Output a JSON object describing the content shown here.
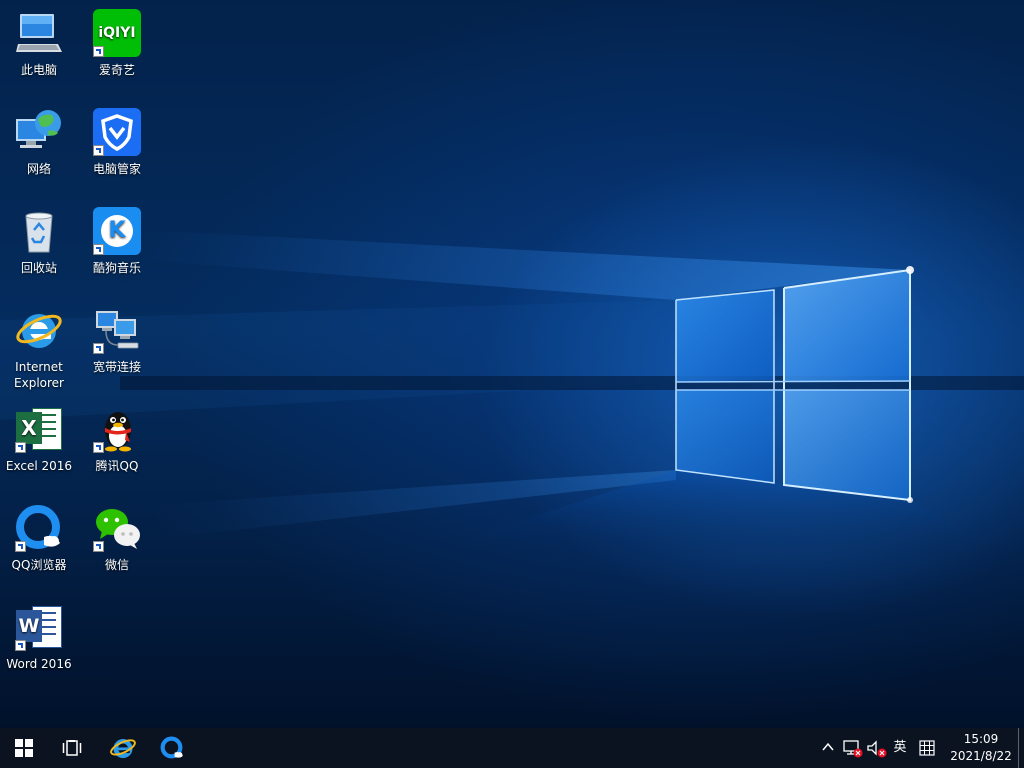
{
  "desktop": {
    "icons": [
      {
        "id": "this-pc",
        "label": "此电脑"
      },
      {
        "id": "iqiyi",
        "label": "爱奇艺",
        "tile_text": "iQIYI"
      },
      {
        "id": "network",
        "label": "网络"
      },
      {
        "id": "pc-manager",
        "label": "电脑管家"
      },
      {
        "id": "recycle-bin",
        "label": "回收站"
      },
      {
        "id": "kugou",
        "label": "酷狗音乐",
        "tile_text": "K"
      },
      {
        "id": "internet-explorer",
        "label": "Internet Explorer"
      },
      {
        "id": "broadband",
        "label": "宽带连接"
      },
      {
        "id": "excel",
        "label": "Excel 2016",
        "tile_text": "X"
      },
      {
        "id": "tencent-qq",
        "label": "腾讯QQ"
      },
      {
        "id": "qq-browser",
        "label": "QQ浏览器"
      },
      {
        "id": "wechat",
        "label": "微信"
      },
      {
        "id": "word",
        "label": "Word 2016",
        "tile_text": "W"
      }
    ]
  },
  "taskbar": {
    "buttons": [
      "start-icon",
      "task-view-icon",
      "internet-explorer-icon",
      "qq-browser-icon"
    ],
    "tray": {
      "chevron": "chevron-up-icon",
      "network": "network-disconnected-icon",
      "volume": "volume-muted-icon",
      "ime_label": "英",
      "ime_mode": "keyboard-grid-icon"
    },
    "clock": {
      "time": "15:09",
      "date": "2021/8/22"
    }
  },
  "colors": {
    "taskbar": "#0b1220",
    "iqiyi": "#00be06",
    "pc_manager": "#1b6ef3",
    "kugou": "#1a8ef0",
    "excel": "#1d6f42",
    "word": "#2b579a",
    "wechat": "#2dc100"
  }
}
